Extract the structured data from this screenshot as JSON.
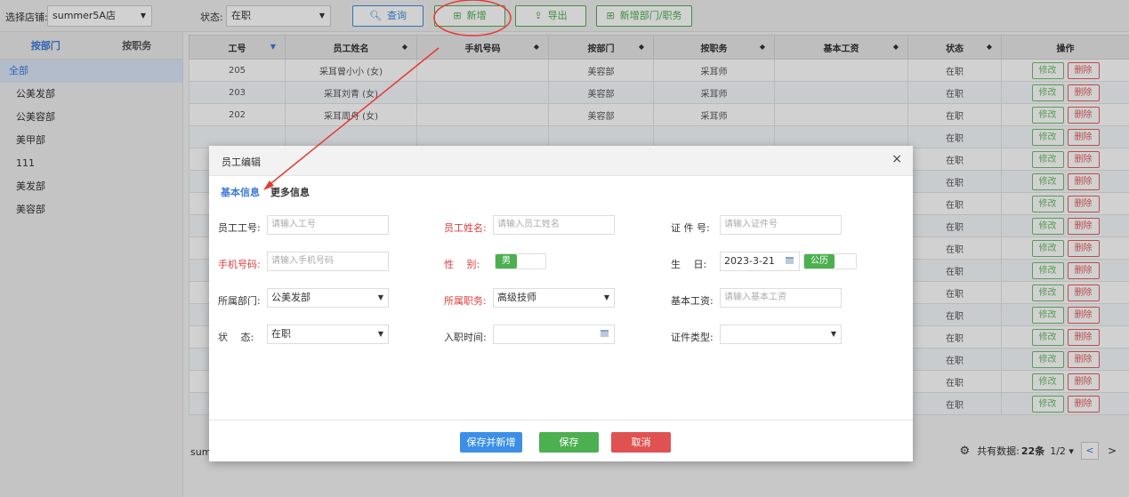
{
  "toolbar": {
    "store_label": "选择店铺:",
    "store_value": "summer5A店",
    "status_label": "状态:",
    "status_value": "在职",
    "query_label": "查询",
    "add_label": "新增",
    "export_label": "导出",
    "add_dept_label": "新增部门/职务"
  },
  "sidebar": {
    "tabs": [
      "按部门",
      "按职务"
    ],
    "items": [
      "全部",
      "公美发部",
      "公美容部",
      "美甲部",
      "111",
      "美发部",
      "美容部"
    ]
  },
  "table": {
    "headers": [
      "工号",
      "员工姓名",
      "手机号码",
      "按部门",
      "按职务",
      "基本工资",
      "状态",
      "操作"
    ],
    "rows": [
      [
        "205",
        "采耳曾小小 (女)",
        "",
        "美容部",
        "采耳师",
        "",
        "在职"
      ],
      [
        "203",
        "采耳刘青 (女)",
        "",
        "美容部",
        "采耳师",
        "",
        "在职"
      ],
      [
        "202",
        "采耳周舟 (女)",
        "",
        "美容部",
        "采耳师",
        "",
        "在职"
      ],
      [
        "",
        "",
        "",
        "",
        "",
        "",
        "在职"
      ],
      [
        "",
        "",
        "",
        "",
        "",
        "",
        "在职"
      ],
      [
        "",
        "",
        "",
        "",
        "",
        "",
        "在职"
      ],
      [
        "",
        "",
        "",
        "",
        "",
        "",
        "在职"
      ],
      [
        "",
        "",
        "",
        "",
        "",
        "",
        "在职"
      ],
      [
        "",
        "",
        "",
        "",
        "",
        "",
        "在职"
      ],
      [
        "",
        "",
        "",
        "",
        "",
        "",
        "在职"
      ],
      [
        "",
        "",
        "",
        "",
        "",
        "",
        "在职"
      ],
      [
        "",
        "",
        "",
        "",
        "",
        "",
        "在职"
      ],
      [
        "",
        "",
        "",
        "",
        "",
        "",
        "在职"
      ],
      [
        "",
        "",
        "",
        "",
        "",
        "",
        "在职"
      ],
      [
        "",
        "",
        "",
        "",
        "",
        "",
        "在职"
      ],
      [
        "",
        "",
        "",
        "",
        "",
        "",
        "在职"
      ]
    ],
    "edit_label": "修改",
    "delete_label": "删除"
  },
  "footer": {
    "left_text": "sum",
    "total_prefix": "共有数据:",
    "total_count": "22条",
    "page": "1/2",
    "prev": "<",
    "next": ">"
  },
  "modal": {
    "title": "员工编辑",
    "close": "×",
    "tabs": [
      "基本信息",
      "更多信息"
    ],
    "fields": {
      "emp_no": {
        "label": "员工工号:",
        "placeholder": "请输入工号"
      },
      "emp_name": {
        "label": "员工姓名:",
        "placeholder": "请输入员工姓名"
      },
      "id_no": {
        "label": "证 件 号:",
        "placeholder": "请输入证件号"
      },
      "phone": {
        "label": "手机号码:",
        "placeholder": "请输入手机号码"
      },
      "gender": {
        "label": "性　 别:",
        "value": "男"
      },
      "birthday": {
        "label": "生　 日:",
        "value": "2023-3-21",
        "calendar_type": "公历"
      },
      "dept": {
        "label": "所属部门:",
        "value": "公美发部"
      },
      "position": {
        "label": "所属职务:",
        "value": "高级技师"
      },
      "salary": {
        "label": "基本工资:",
        "placeholder": "请输入基本工资"
      },
      "status": {
        "label": "状　 态:",
        "value": "在职"
      },
      "hire_date": {
        "label": "入职时间:",
        "value": ""
      },
      "id_type": {
        "label": "证件类型:",
        "value": ""
      }
    },
    "buttons": {
      "save_new": "保存并新增",
      "save": "保存",
      "cancel": "取消"
    }
  },
  "colors": {
    "accent_blue": "#3b7ad8",
    "green": "#4caf50",
    "red": "#e05252",
    "annotation": "#e53935"
  }
}
